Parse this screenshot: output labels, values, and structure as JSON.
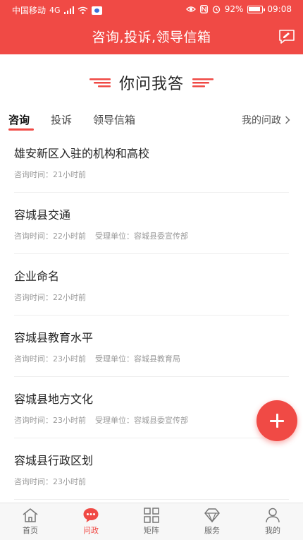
{
  "status_bar": {
    "carrier": "中国移动",
    "network": "4G",
    "battery_percent": "92%",
    "battery_level": 0.92,
    "time": "09:08"
  },
  "header": {
    "title": "咨询,投诉,领导信箱",
    "action_icon": "message-edit-icon"
  },
  "section": {
    "title": "你问我答"
  },
  "tabs": [
    {
      "label": "咨询",
      "active": true
    },
    {
      "label": "投诉",
      "active": false
    },
    {
      "label": "领导信箱",
      "active": false
    }
  ],
  "my_link": "我的问政",
  "items": [
    {
      "title": "雄安新区入驻的机构和高校",
      "time_label": "咨询时间：21小时前",
      "unit_label": ""
    },
    {
      "title": "容城县交通",
      "time_label": "咨询时间：22小时前",
      "unit_label": "受理单位：容城县委宣传部"
    },
    {
      "title": "企业命名",
      "time_label": "咨询时间：22小时前",
      "unit_label": ""
    },
    {
      "title": "容城县教育水平",
      "time_label": "咨询时间：23小时前",
      "unit_label": "受理单位：容城县教育局"
    },
    {
      "title": "容城县地方文化",
      "time_label": "咨询时间：23小时前",
      "unit_label": "受理单位：容城县委宣传部"
    },
    {
      "title": "容城县行政区划",
      "time_label": "咨询时间：23小时前",
      "unit_label": ""
    }
  ],
  "bottom_nav": [
    {
      "label": "首页",
      "icon": "home-icon",
      "active": false
    },
    {
      "label": "问政",
      "icon": "chat-bubble-icon",
      "active": true
    },
    {
      "label": "矩阵",
      "icon": "grid-icon",
      "active": false
    },
    {
      "label": "服务",
      "icon": "diamond-icon",
      "active": false
    },
    {
      "label": "我的",
      "icon": "user-icon",
      "active": false
    }
  ],
  "colors": {
    "brand_red": "#f04a45",
    "text_dark": "#222222",
    "text_meta": "#9a9a9a",
    "nav_background": "#f7f7f7"
  }
}
